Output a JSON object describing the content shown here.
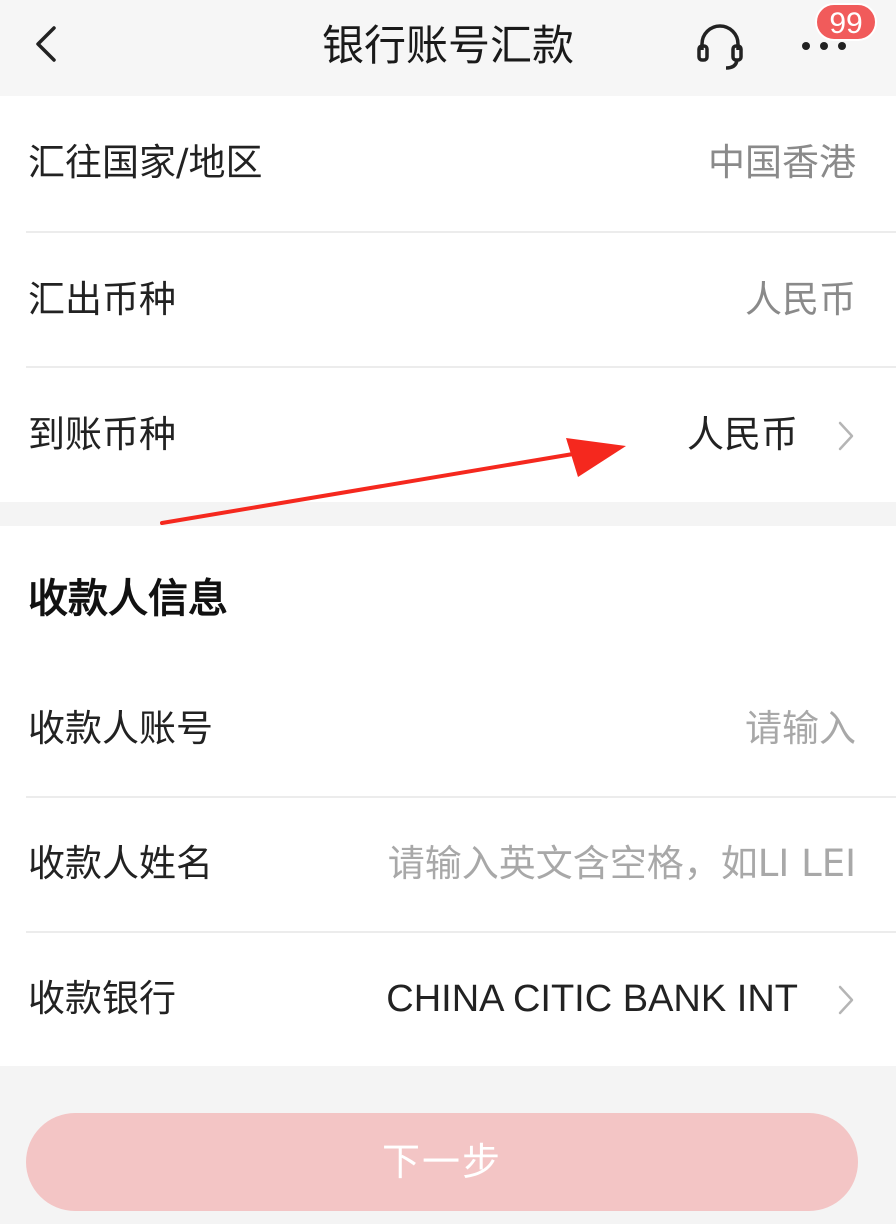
{
  "nav": {
    "title": "银行账号汇款",
    "back_icon": "chevron-left-icon",
    "service_icon": "headset-icon",
    "more_icon": "more-dots-icon",
    "badge_count": "99",
    "badge_color": "#f15b5b"
  },
  "remit": {
    "rows": [
      {
        "label": "汇往国家/地区",
        "value": "中国香港"
      },
      {
        "label": "汇出币种",
        "value": "人民币"
      },
      {
        "label": "到账币种",
        "value": "人民币"
      }
    ]
  },
  "payee": {
    "section_title": "收款人信息",
    "account": {
      "label": "收款人账号",
      "placeholder": "请输入"
    },
    "name": {
      "label": "收款人姓名",
      "placeholder": "请输入英文含空格，如LI LEI"
    },
    "bank": {
      "label": "收款银行",
      "value": "CHINA CITIC BANK INT"
    }
  },
  "next_button": {
    "label": "下一步",
    "color": "#f3c5c5"
  },
  "annotation": {
    "arrow_color": "#f5281e"
  }
}
